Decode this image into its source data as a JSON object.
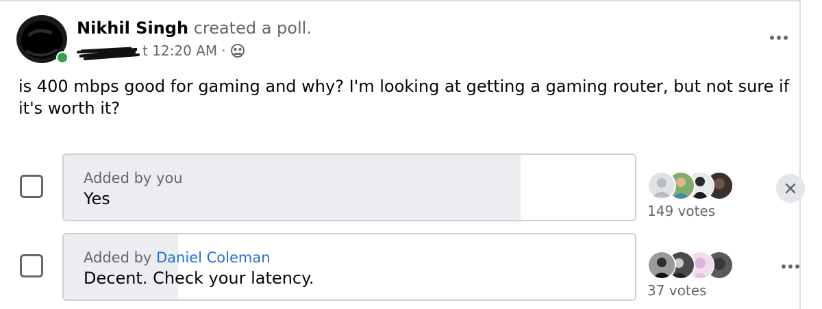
{
  "post": {
    "author": "Nikhil Singh",
    "action": "created a poll.",
    "time": "t 12:20 AM",
    "separator": "·",
    "audience_icon": "friends-icon",
    "text": "is 400 mbps good for gaming and why? I'm looking at getting a gaming router, but not sure if it's worth it?"
  },
  "poll": {
    "options": [
      {
        "added_by_prefix": "Added by you",
        "added_by_name": "",
        "text": "Yes",
        "votes": "149 votes",
        "vote_share": 0.8,
        "checked": false,
        "trailing_icon": "close-icon"
      },
      {
        "added_by_prefix": "Added by ",
        "added_by_name": "Daniel Coleman",
        "text": "Decent. Check your latency.",
        "votes": "37 votes",
        "vote_share": 0.2,
        "checked": false,
        "trailing_icon": "more-icon"
      }
    ]
  },
  "colors": {
    "link": "#216fdb",
    "secondary_text": "#65676b",
    "fill": "#ebedf0",
    "online": "#31a24c"
  }
}
